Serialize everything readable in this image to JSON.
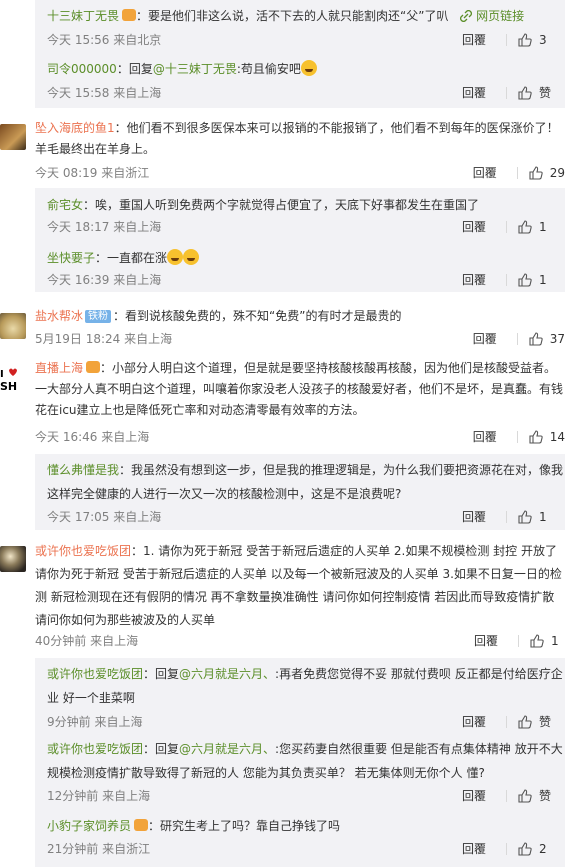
{
  "c1": {
    "sub1": {
      "name": "十三妹丁无畏",
      "text": "：要是他们非这么说，活不下去的人就只能割肉还“父”了叭",
      "link": "网页链接",
      "time": "今天 15:56 来自北京",
      "reply": "回覆",
      "likes": "3"
    },
    "sub2": {
      "name": "司令000000",
      "text": "：回复",
      "at": "@十三妹丁无畏",
      "text2": ":苟且偷安吧",
      "time": "今天 15:58 来自上海",
      "reply": "回覆",
      "likes": "赞"
    }
  },
  "c2": {
    "name": "坠入海底的鱼1",
    "text": "：他们看不到很多医保本来可以报销的不能报销了，他们看不到每年的医保涨价了！羊毛最终出在羊身上。",
    "time": "今天 08:19 来自浙江",
    "reply": "回覆",
    "likes": "29",
    "sub1": {
      "name": "俞宅女",
      "text": "：唉，重国人听到免费两个字就觉得占便宜了，天底下好事都发生在重国了",
      "time": "今天 18:17 来自上海",
      "reply": "回覆",
      "likes": "1"
    },
    "sub2": {
      "name": "坐快要子",
      "text": "：一直都在涨",
      "time": "今天 16:39 来自上海",
      "reply": "回覆",
      "likes": "1"
    }
  },
  "c3": {
    "name": "盐水帮冰",
    "badge": "铁粉",
    "text": "：看到说核酸免费的，殊不知“免费”的有时才是最贵的",
    "time": "5月19日 18:24 来自上海",
    "reply": "回覆",
    "likes": "37"
  },
  "c4": {
    "name": "直播上海",
    "text": "：小部分人明白这个道理，但是就是要坚持核酸核酸再核酸，因为他们是核酸受益者。一大部分人真不明白这个道理，叫嚷着你家没老人没孩子的核酸爱好者，他们不是坏，是真蠢。有钱花在icu建立上也是降低死亡率和对动态清零最有效率的方法。",
    "time": "今天 16:46 来自上海",
    "reply": "回覆",
    "likes": "14",
    "sub1": {
      "name": "懂么弗懂是我",
      "text": "：我虽然没有想到这一步，但是我的推理逻辑是，为什么我们要把资源花在对，像我这样完全健康的人进行一次又一次的核酸检测中，这是不是浪费呢?",
      "time": "今天 17:05 来自上海",
      "reply": "回覆",
      "likes": "1"
    }
  },
  "c5": {
    "name": "或许你也爱吃饭团",
    "text": "：1. 请你为死于新冠 受苦于新冠后遗症的人买单 2.如果不规模检测 封控 开放了 请你为死于新冠 受苦于新冠后遗症的人买单 以及每一个被新冠波及的人买单 3.如果不日复一日的检测 新冠检测现在还有假阴的情况 再不拿数量换准确性 请问你如何控制疫情 若因此而导致疫情扩散 请问你如何为那些被波及的人买单",
    "time": "40分钟前 来自上海",
    "reply": "回覆",
    "likes": "1",
    "sub1": {
      "name": "或许你也爱吃饭团",
      "text": "：回复",
      "at": "@六月就是六月、",
      "text2": ":再者免费您觉得不妥 那就付费呗 反正都是付给医疗企业 好一个韭菜啊",
      "time": "9分钟前 来自上海",
      "reply": "回覆",
      "likes": "赞"
    },
    "sub2": {
      "name": "或许你也爱吃饭团",
      "text": "：回复",
      "at": "@六月就是六月、",
      "text2": ":您买药妻自然很重要 但是能否有点集体精神 放开不大规模检测疫情扩散导致得了新冠的人 您能为其负责买单？ 若无集体则无你个人 懂?",
      "time": "12分钟前 来自上海",
      "reply": "回覆",
      "likes": "赞"
    },
    "sub3": {
      "name": "小豹子家饲养员",
      "text": "：研究生考上了吗？靠自己挣钱了吗",
      "time": "21分钟前 来自浙江",
      "reply": "回覆",
      "likes": "2"
    }
  }
}
